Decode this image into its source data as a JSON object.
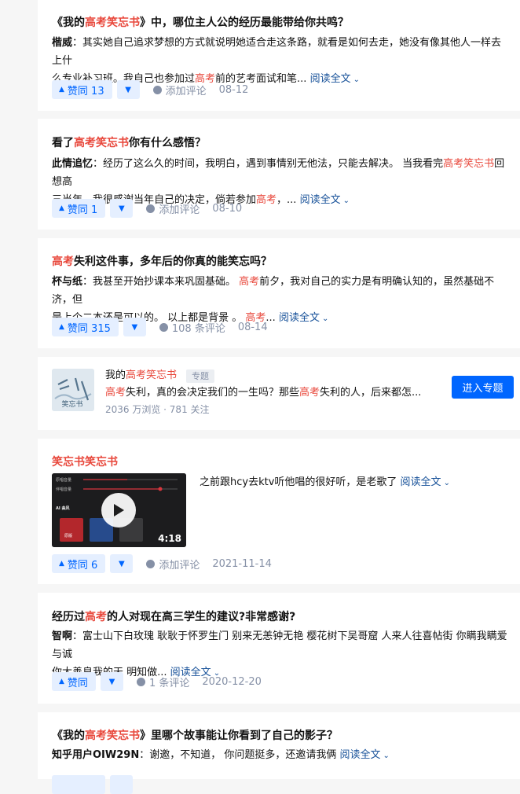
{
  "cards": [
    {
      "title_pre": "《我的",
      "title_hl": "高考笑忘书",
      "title_post": "》中，哪位主人公的经历最能带给你共鸣？",
      "author": "楷威",
      "line1": "：其实她自己追求梦想的方式就说明她适合走这条路，就看是如何去走，她没有像其他人一样去上什",
      "line2_pre": "么专业补习班。我自己也参加过",
      "line2_hl": "高考",
      "line2_post": "前的艺考面试和笔...",
      "more": "阅读全文",
      "vote": "赞同 13",
      "comment": "添加评论",
      "date": "08-12"
    },
    {
      "title_pre": "看了",
      "title_hl": "高考笑忘书",
      "title_post": "你有什么感悟？",
      "author": "此情追忆",
      "line1_pre": "：经历了这么久的时间，我明白，遇到事情别无他法，只能去解决。 当我看完",
      "line1_hl": "高考笑忘书",
      "line1_post": "回想高",
      "line2_pre": "三当年，我很感谢当年自己的决定，倘若参加",
      "line2_hl": "高考",
      "line2_post": "，...",
      "more": "阅读全文",
      "vote": "赞同 1",
      "comment": "添加评论",
      "date": "08-10"
    },
    {
      "title_hl": "高考",
      "title_post": "失利这件事，多年后的你真的能笑忘吗？",
      "author": "杯与纸",
      "line1_pre": "：我甚至开始抄课本来巩固基础。 ",
      "line1_hl": "高考",
      "line1_post": "前夕，我对自己的实力是有明确认知的，虽然基础不济，但",
      "line2_pre": "是上个二本还是可以的。 以上都是背景 。 ",
      "line2_hl": "高考",
      "line2_post": "...",
      "more": "阅读全文",
      "vote": "赞同 315",
      "comment": "108 条评论",
      "date": "08-14"
    }
  ],
  "topic": {
    "name_pre": "我的",
    "name_hl": "高考笑忘书",
    "tag": "专题",
    "desc_hl1": "高考",
    "desc_mid": "失利，真的会决定我们的一生吗？那些",
    "desc_hl2": "高考",
    "desc_post": "失利的人，后来都怎...",
    "stats": "2036 万浏览 · 781 关注",
    "button": "进入专题",
    "cover_text": "笑忘书"
  },
  "video": {
    "title": "笑忘书笑忘书",
    "text": "之前跟hcy去ktv听他唱的很好听，是老歌了",
    "more": "阅读全文",
    "duration": "4:18",
    "thumb_label_1": "原唱音量",
    "thumb_label_2": "伴唱音量",
    "thumb_label_3": "AI 曲风",
    "thumb_label_4": "原版",
    "vote": "赞同 6",
    "comment": "添加评论",
    "date": "2021-11-14"
  },
  "card4": {
    "title_pre": "经历过",
    "title_hl": "高考",
    "title_post": "的人对现在高三学生的建议?非常感谢?",
    "author": "智啊",
    "line1": "：富士山下白玫瑰 耿耿于怀罗生门 别来无恙钟无艳 樱花树下吴哥窟 人来人往喜帖街 你瞒我瞒爱与诚",
    "line2": "你大善良我的天 明知做...",
    "more": "阅读全文",
    "vote": "赞同",
    "comment": "1 条评论",
    "date": "2020-12-20"
  },
  "card5": {
    "title_pre": "《我的",
    "title_hl": "高考笑忘书",
    "title_post": "》里哪个故事能让你看到了自己的影子？",
    "author": "知乎用户OIW29N",
    "line1": "：谢邀，不知道， 你问题挺多，还邀请我俩",
    "more": "阅读全文"
  },
  "colors": {
    "accent": "#0066ff",
    "highlight": "#e8473b",
    "link": "#175199",
    "muted": "#8590a6"
  }
}
